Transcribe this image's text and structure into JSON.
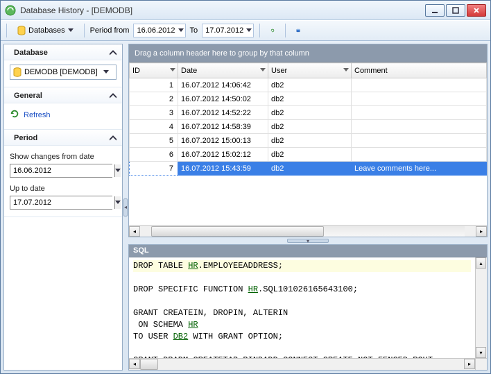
{
  "window": {
    "title": "Database History - [DEMODB]"
  },
  "toolbar": {
    "databases_label": "Databases",
    "period_from_label": "Period from",
    "to_label": "To",
    "date_from": "16.06.2012",
    "date_to": "17.07.2012"
  },
  "sidebar": {
    "database_header": "Database",
    "database_selected": "DEMODB [DEMODB]",
    "general_header": "General",
    "refresh_label": "Refresh",
    "period_header": "Period",
    "from_label": "Show changes from date",
    "to_label": "Up to date",
    "from_value": "16.06.2012",
    "to_value": "17.07.2012"
  },
  "grid": {
    "group_hint": "Drag a column header here to group by that column",
    "columns": {
      "id": "ID",
      "date": "Date",
      "user": "User",
      "comment": "Comment"
    },
    "rows": [
      {
        "id": "1",
        "date": "16.07.2012 14:06:42",
        "user": "db2",
        "comment": ""
      },
      {
        "id": "2",
        "date": "16.07.2012 14:50:02",
        "user": "db2",
        "comment": ""
      },
      {
        "id": "3",
        "date": "16.07.2012 14:52:22",
        "user": "db2",
        "comment": ""
      },
      {
        "id": "4",
        "date": "16.07.2012 14:58:39",
        "user": "db2",
        "comment": ""
      },
      {
        "id": "5",
        "date": "16.07.2012 15:00:13",
        "user": "db2",
        "comment": ""
      },
      {
        "id": "6",
        "date": "16.07.2012 15:02:12",
        "user": "db2",
        "comment": ""
      },
      {
        "id": "7",
        "date": "16.07.2012 15:43:59",
        "user": "db2",
        "comment": "Leave comments here..."
      }
    ]
  },
  "sql": {
    "header": "SQL",
    "lines": [
      {
        "t": "DROP TABLE ",
        "s": "HR",
        "r": ".EMPLOYEEADDRESS;",
        "hl": true
      },
      {
        "blank": true
      },
      {
        "t": "DROP SPECIFIC FUNCTION ",
        "s": "HR",
        "r": ".SQL101026165643100;"
      },
      {
        "blank": true
      },
      {
        "t": "GRANT CREATEIN, DROPIN, ALTERIN"
      },
      {
        "t": " ON SCHEMA ",
        "s": "HR"
      },
      {
        "t": "TO USER ",
        "s": "DB2",
        "r": " WITH GRANT OPTION;"
      },
      {
        "blank": true
      },
      {
        "t": "GRANT DBADM CREATETAB BINDADD CONNECT CREATE_NOT_FENCED ROUT"
      }
    ]
  }
}
